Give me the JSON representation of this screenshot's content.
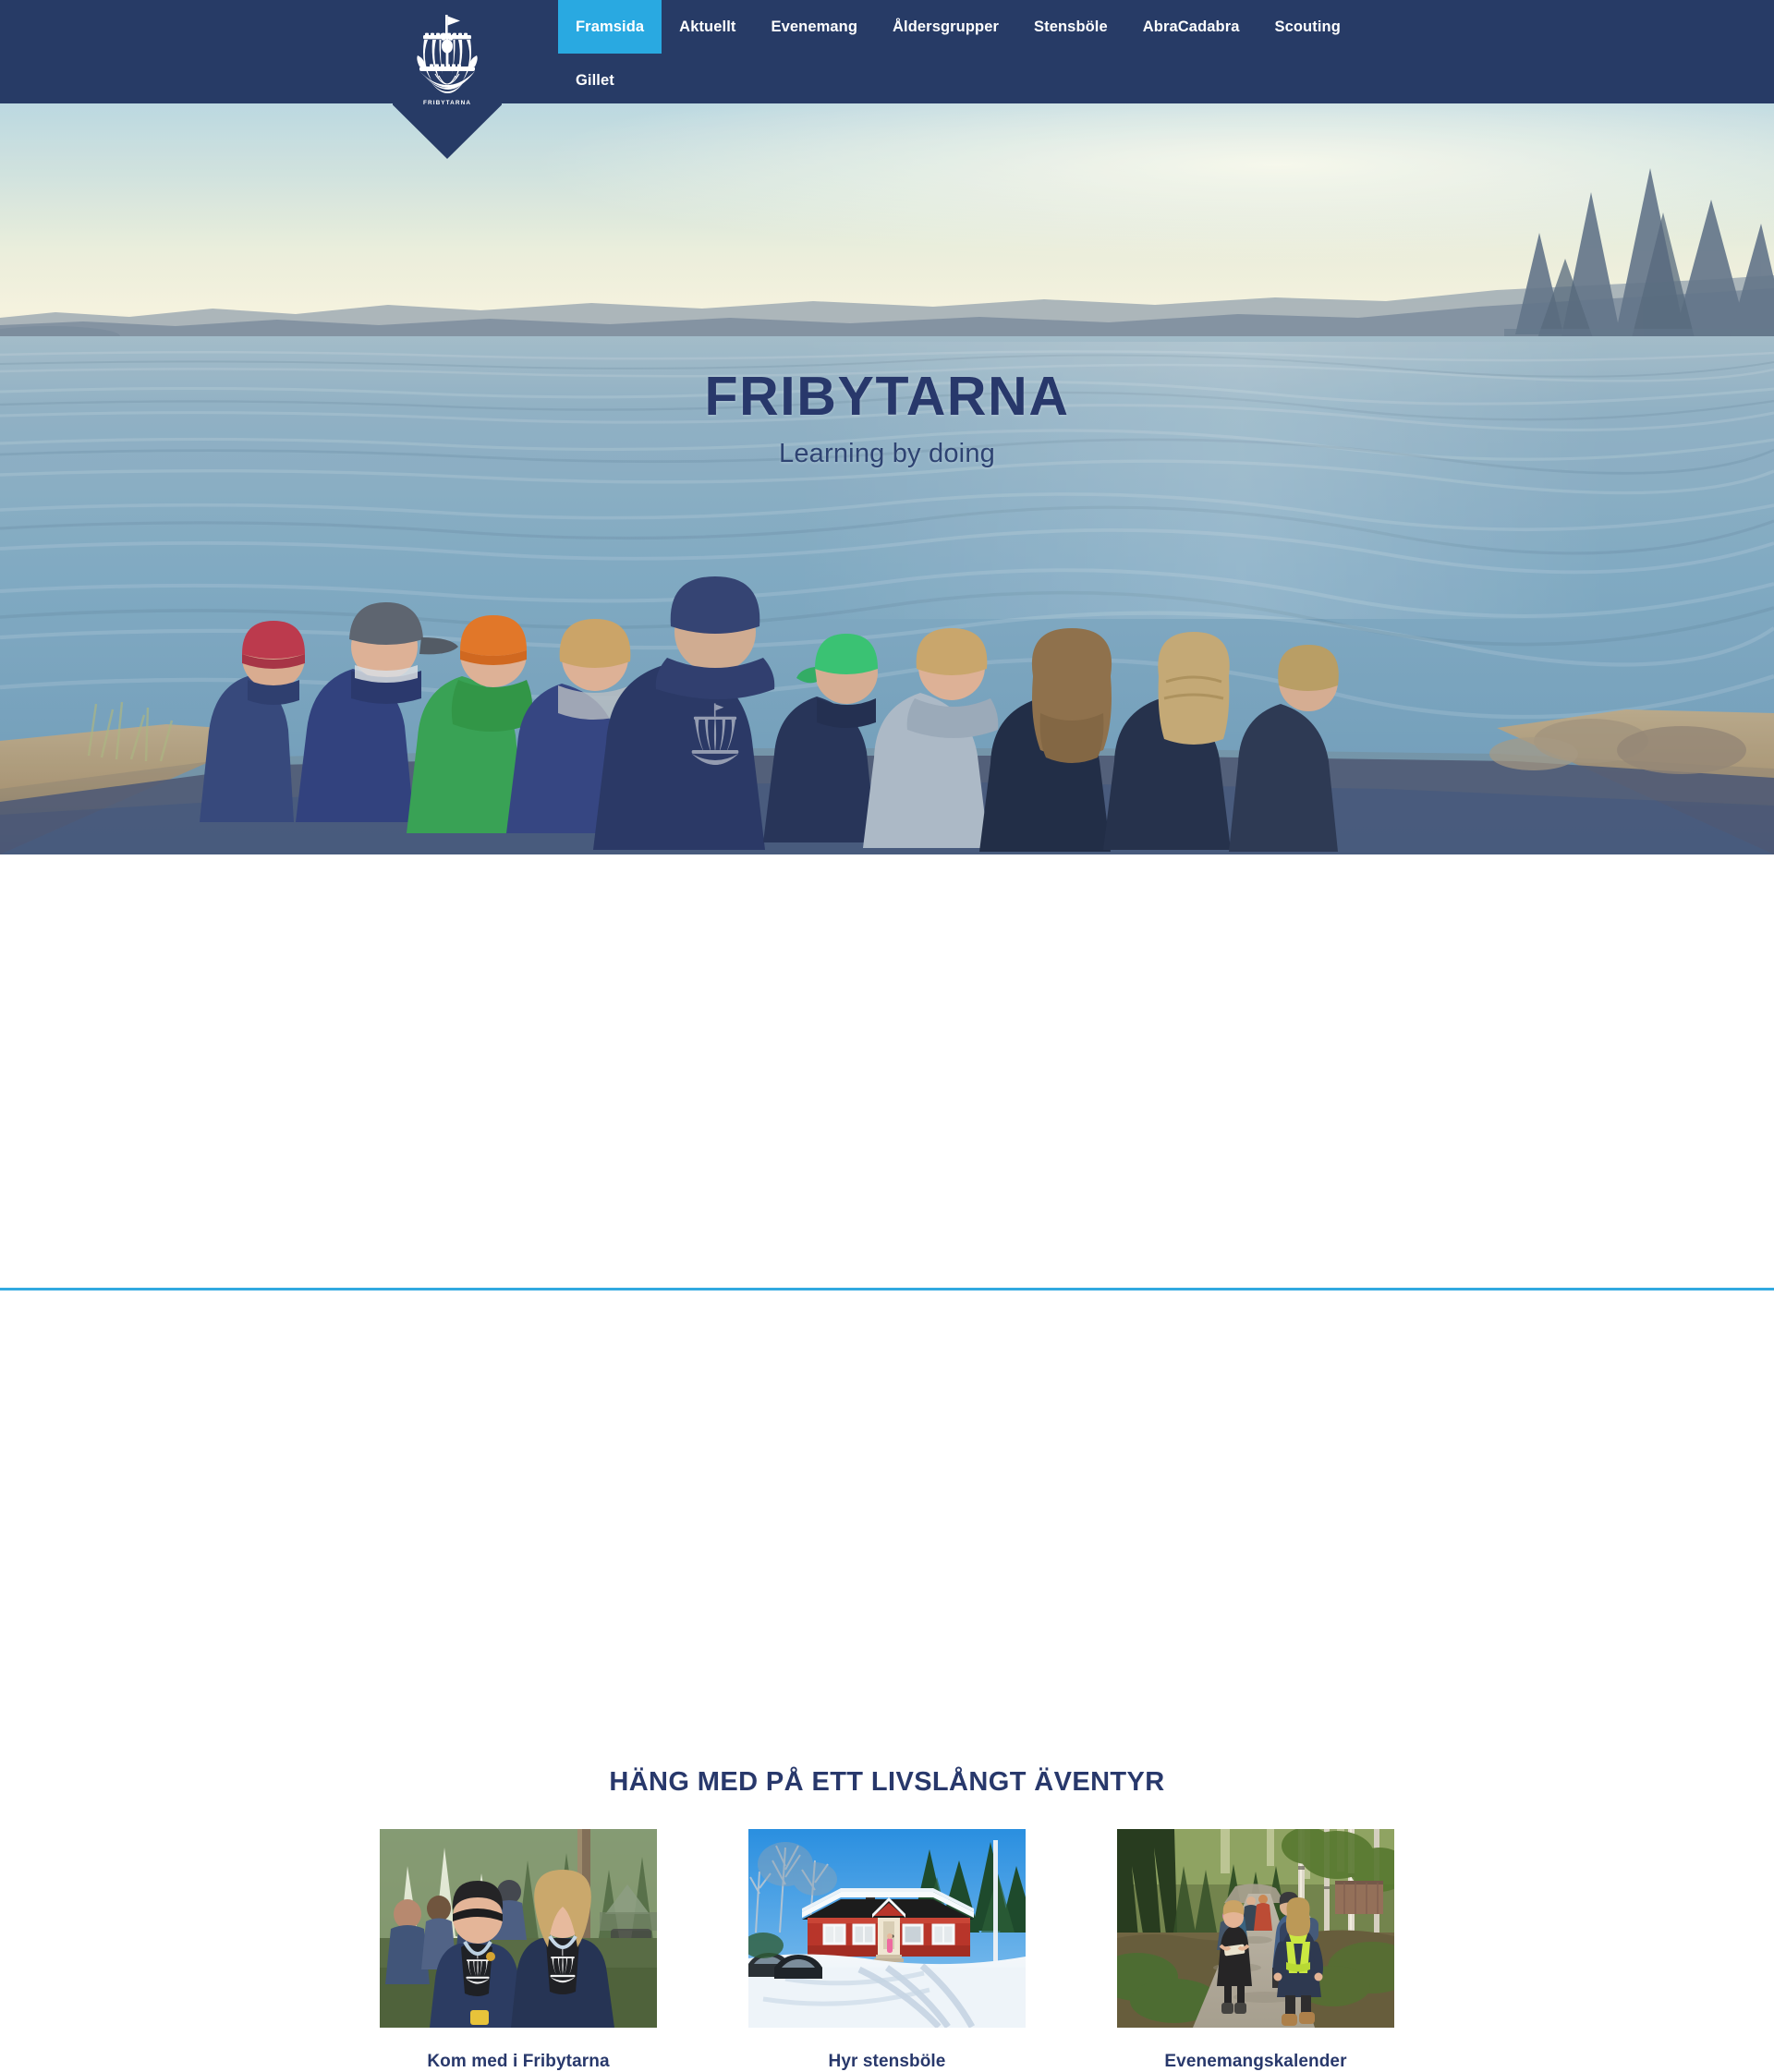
{
  "brand": {
    "name": "FRIBYTARNA",
    "logo_icon": "viking-ship-crown-logo",
    "logo_text": "FRIBYTARNA",
    "navy": "#273b66",
    "accent": "#29a9e1"
  },
  "nav": {
    "items": [
      {
        "label": "Framsida",
        "active": true
      },
      {
        "label": "Aktuellt",
        "active": false
      },
      {
        "label": "Evenemang",
        "active": false
      },
      {
        "label": "Åldersgrupper",
        "active": false
      },
      {
        "label": "Stensböle",
        "active": false
      },
      {
        "label": "AbraCadabra",
        "active": false
      },
      {
        "label": "Scouting",
        "active": false
      },
      {
        "label": "Gillet",
        "active": false
      }
    ]
  },
  "hero": {
    "title": "FRIBYTARNA",
    "subtitle": "Learning by doing",
    "scene": "archipelago lake at golden hour with nine children seated on a rocky shore facing the water"
  },
  "main": {
    "section_title": "HÄNG MED PÅ ETT LIVSLÅNGT ÄVENTYR",
    "cards": [
      {
        "caption": "Kom med i Fribytarna",
        "image": "two-scouts-smiling-at-camp"
      },
      {
        "caption": "Hyr stensböle",
        "image": "red-cottage-in-snow"
      },
      {
        "caption": "Evenemangskalender",
        "image": "hikers-on-forest-road"
      }
    ]
  }
}
